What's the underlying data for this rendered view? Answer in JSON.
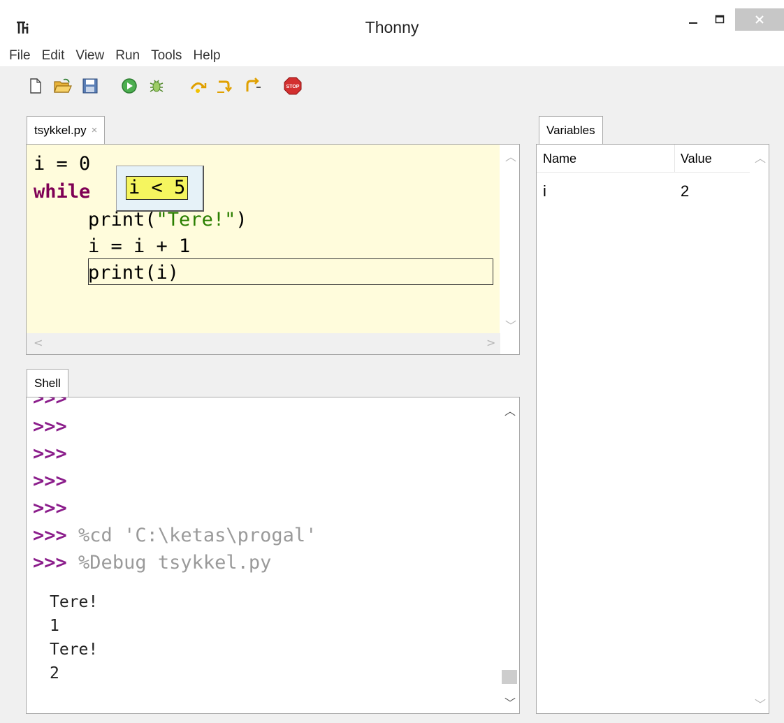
{
  "window": {
    "title": "Thonny"
  },
  "menu": [
    "File",
    "Edit",
    "View",
    "Run",
    "Tools",
    "Help"
  ],
  "toolbar": {
    "icons": [
      "new-file-icon",
      "open-folder-icon",
      "save-icon",
      "run-icon",
      "debug-icon",
      "step-over-icon",
      "step-into-icon",
      "step-out-icon",
      "stop-icon"
    ],
    "stop_label": "STOP"
  },
  "editor": {
    "tab_label": "tsykkel.py",
    "close_glyph": "×",
    "lines": [
      "i = 0",
      "while",
      "print(",
      "\"Tere!\"",
      ")",
      "i = i + 1",
      "print(i)"
    ],
    "eval_expression": "i < 5"
  },
  "shell": {
    "tab_label": "Shell",
    "prompt": ">>>",
    "commands": [
      "%cd 'C:\\ketas\\progal'",
      "%Debug tsykkel.py"
    ],
    "output": [
      "Tere!",
      "1",
      "Tere!",
      "2"
    ]
  },
  "variables": {
    "tab_label": "Variables",
    "columns": [
      "Name",
      "Value"
    ],
    "rows": [
      {
        "name": "i",
        "value": "2"
      }
    ]
  },
  "colors": {
    "editor_bg": "#fffcdc",
    "keyword": "#7f0055",
    "string": "#2a7f00",
    "prompt": "#8b1d8b",
    "highlight": "#f5f55f"
  }
}
